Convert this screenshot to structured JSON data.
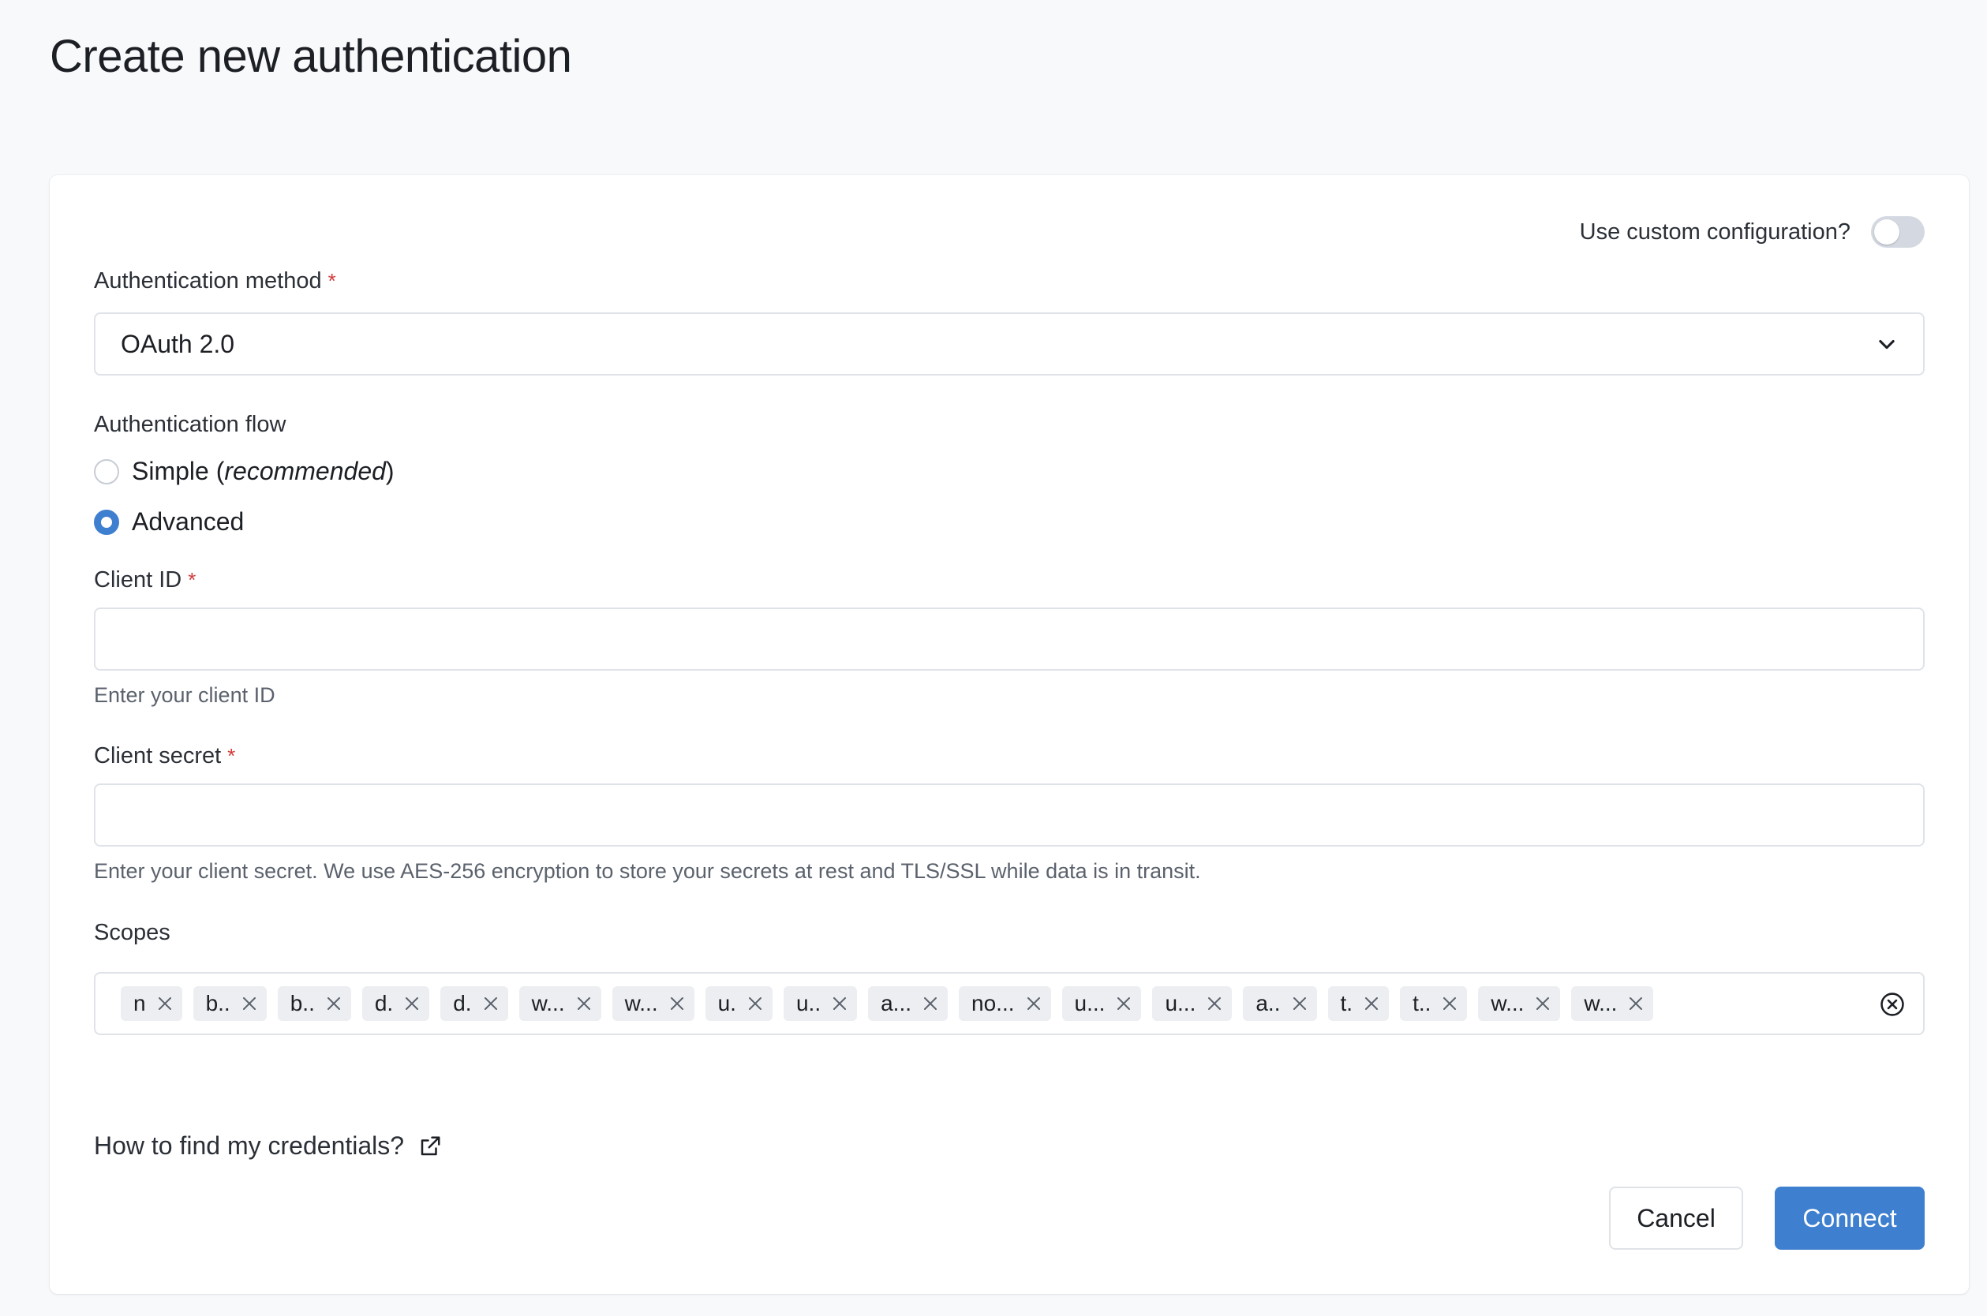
{
  "page": {
    "title": "Create new authentication"
  },
  "custom_config": {
    "label": "Use custom configuration?",
    "enabled": false
  },
  "auth_method": {
    "label": "Authentication method",
    "required_mark": "*",
    "value": "OAuth 2.0"
  },
  "auth_flow": {
    "label": "Authentication flow",
    "options": [
      {
        "label": "Simple (",
        "emphasis": "recommended",
        "suffix": ")",
        "checked": false
      },
      {
        "label": "Advanced",
        "checked": true
      }
    ]
  },
  "client_id": {
    "label": "Client ID",
    "required_mark": "*",
    "value": "",
    "help": "Enter your client ID"
  },
  "client_secret": {
    "label": "Client secret",
    "required_mark": "*",
    "value": "",
    "help": "Enter your client secret. We use AES-256 encryption to store your secrets at rest and TLS/SSL while data is in transit."
  },
  "scopes": {
    "label": "Scopes",
    "chips": [
      "n",
      "b..",
      "b..",
      "d.",
      "d.",
      "w...",
      "w...",
      "u.",
      "u..",
      "a...",
      "no...",
      "u...",
      "u...",
      "a..",
      "t.",
      "t..",
      "w...",
      "w..."
    ]
  },
  "help_link": {
    "label": "How to find my credentials?"
  },
  "buttons": {
    "cancel": "Cancel",
    "connect": "Connect"
  },
  "colors": {
    "accent": "#3f7fcf",
    "required": "#d23b3b"
  },
  "icons": {
    "select": "chevron-down-icon",
    "chip_remove": "close-icon",
    "clear": "circle-close-icon",
    "link": "external-link-icon"
  }
}
